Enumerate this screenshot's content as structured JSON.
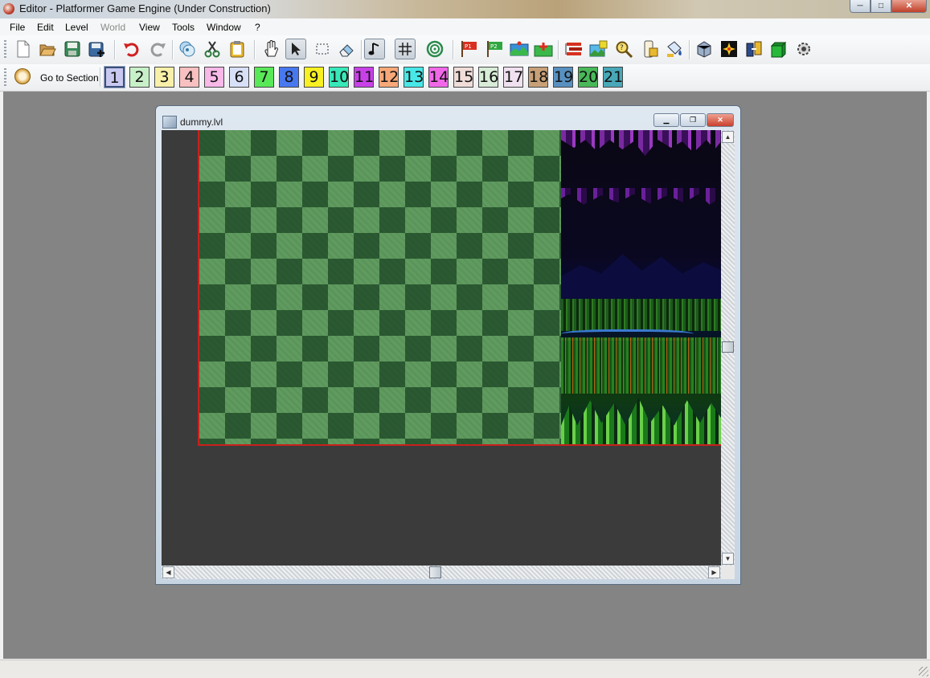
{
  "window": {
    "title": "Editor - Platformer Game Engine (Under Construction)",
    "minimize": "─",
    "maximize": "□",
    "close": "✕"
  },
  "menu": [
    {
      "label": "File",
      "enabled": true
    },
    {
      "label": "Edit",
      "enabled": true
    },
    {
      "label": "Level",
      "enabled": true
    },
    {
      "label": "World",
      "enabled": false
    },
    {
      "label": "View",
      "enabled": true
    },
    {
      "label": "Tools",
      "enabled": true
    },
    {
      "label": "Window",
      "enabled": true
    },
    {
      "label": "?",
      "enabled": true
    }
  ],
  "toolbar": {
    "buttons": [
      {
        "name": "new-file-icon"
      },
      {
        "name": "open-file-icon"
      },
      {
        "name": "save-file-icon"
      },
      {
        "name": "save-as-icon"
      },
      {
        "name": "undo-icon"
      },
      {
        "name": "redo-icon"
      },
      {
        "name": "copy-icon"
      },
      {
        "name": "cut-icon"
      },
      {
        "name": "paste-icon"
      },
      {
        "name": "hand-icon"
      },
      {
        "name": "select-arrow-icon",
        "checked": true
      },
      {
        "name": "rect-select-icon"
      },
      {
        "name": "eraser-icon"
      },
      {
        "name": "music-note-icon",
        "checked": true
      },
      {
        "name": "grid-icon",
        "checked": true
      },
      {
        "name": "target-icon"
      },
      {
        "name": "player1-flag-icon"
      },
      {
        "name": "player2-flag-icon"
      },
      {
        "name": "section-settings-icon"
      },
      {
        "name": "add-section-icon"
      },
      {
        "name": "layers-icon"
      },
      {
        "name": "background-image-icon"
      },
      {
        "name": "search-icon"
      },
      {
        "name": "level-properties-icon"
      },
      {
        "name": "bucket-icon"
      },
      {
        "name": "tileset-icon"
      },
      {
        "name": "effects-icon"
      },
      {
        "name": "warp-doors-icon"
      },
      {
        "name": "box-icon"
      },
      {
        "name": "npc-gear-icon"
      }
    ]
  },
  "section_bar": {
    "go_to_label": "Go to Section",
    "active": 1,
    "sections": [
      {
        "label": "1",
        "color": "#c8c8f0"
      },
      {
        "label": "2",
        "color": "#c8f0c8"
      },
      {
        "label": "3",
        "color": "#f8f0a8"
      },
      {
        "label": "4",
        "color": "#f8c0c0"
      },
      {
        "label": "5",
        "color": "#f8b8e8"
      },
      {
        "label": "6",
        "color": "#d8e0f8"
      },
      {
        "label": "7",
        "color": "#58e858"
      },
      {
        "label": "8",
        "color": "#4878f0"
      },
      {
        "label": "9",
        "color": "#f8f020"
      },
      {
        "label": "10",
        "color": "#38e8b8"
      },
      {
        "label": "11",
        "color": "#c840e8"
      },
      {
        "label": "12",
        "color": "#f8a878"
      },
      {
        "label": "13",
        "color": "#48e8e8"
      },
      {
        "label": "14",
        "color": "#f068e8"
      },
      {
        "label": "15",
        "color": "#f0dcd8"
      },
      {
        "label": "16",
        "color": "#d8ecd8"
      },
      {
        "label": "17",
        "color": "#f0e0f0"
      },
      {
        "label": "18",
        "color": "#c8a078"
      },
      {
        "label": "19",
        "color": "#5890c0"
      },
      {
        "label": "20",
        "color": "#48b858"
      },
      {
        "label": "21",
        "color": "#48a8b8"
      }
    ]
  },
  "document": {
    "title": "dummy.lvl"
  },
  "scroll": {
    "v_up": "▲",
    "v_down": "▼",
    "h_left": "◀",
    "h_right": "▶"
  }
}
